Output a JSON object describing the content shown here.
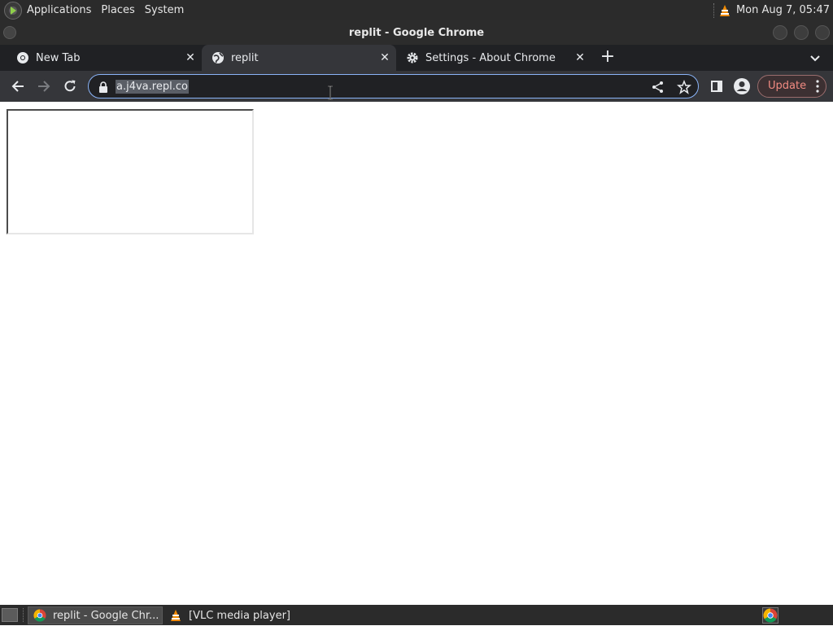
{
  "top_panel": {
    "menus": [
      "Applications",
      "Places",
      "System"
    ],
    "clock": "Mon Aug  7, 05:47"
  },
  "window": {
    "title": "replit - Google Chrome"
  },
  "tabs": [
    {
      "label": "New Tab",
      "icon": "chrome-icon",
      "active": false
    },
    {
      "label": "replit",
      "icon": "globe-icon",
      "active": true
    },
    {
      "label": "Settings - About Chrome",
      "icon": "gear-icon",
      "active": false
    }
  ],
  "toolbar": {
    "url": "a.j4va.repl.co",
    "update_label": "Update"
  },
  "taskbar": {
    "items": [
      {
        "label": "replit - Google Chr...",
        "icon": "chrome-icon",
        "active": true
      },
      {
        "label": "[VLC media player]",
        "icon": "vlc-icon",
        "active": false
      }
    ]
  },
  "colors": {
    "panel_bg": "#2b2b2b",
    "tabstrip_bg": "#202124",
    "toolbar_bg": "#35363a",
    "update_accent": "#f28b82",
    "omnibox_focus": "#8ab4f8"
  }
}
